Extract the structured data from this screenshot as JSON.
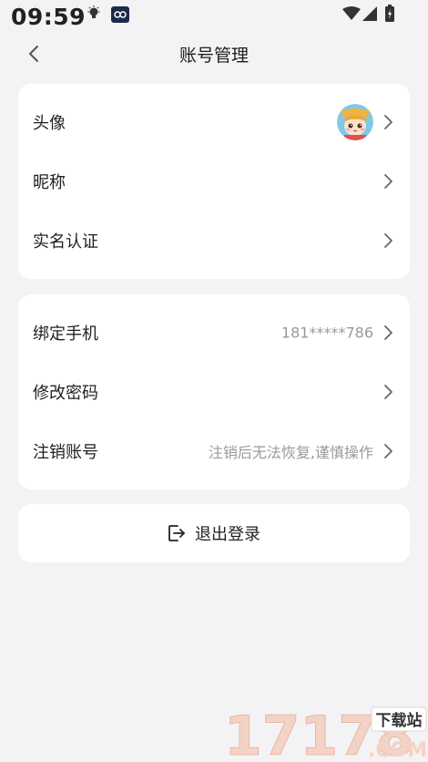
{
  "status_bar": {
    "time": "09:59"
  },
  "nav": {
    "title": "账号管理"
  },
  "profile_card": {
    "rows": [
      {
        "label": "头像",
        "value": ""
      },
      {
        "label": "昵称",
        "value": ""
      },
      {
        "label": "实名认证",
        "value": ""
      }
    ]
  },
  "account_card": {
    "rows": [
      {
        "label": "绑定手机",
        "value": "181*****786"
      },
      {
        "label": "修改密码",
        "value": ""
      },
      {
        "label": "注销账号",
        "value": "注销后无法恢复,谨慎操作"
      }
    ]
  },
  "logout": {
    "label": "退出登录"
  },
  "watermark": {
    "brand": "17178",
    "badge": "下载站",
    "suffix": ".COM"
  },
  "colors": {
    "background": "#f3f3f5",
    "card": "#ffffff",
    "secondary_text": "#9a9a9a"
  }
}
